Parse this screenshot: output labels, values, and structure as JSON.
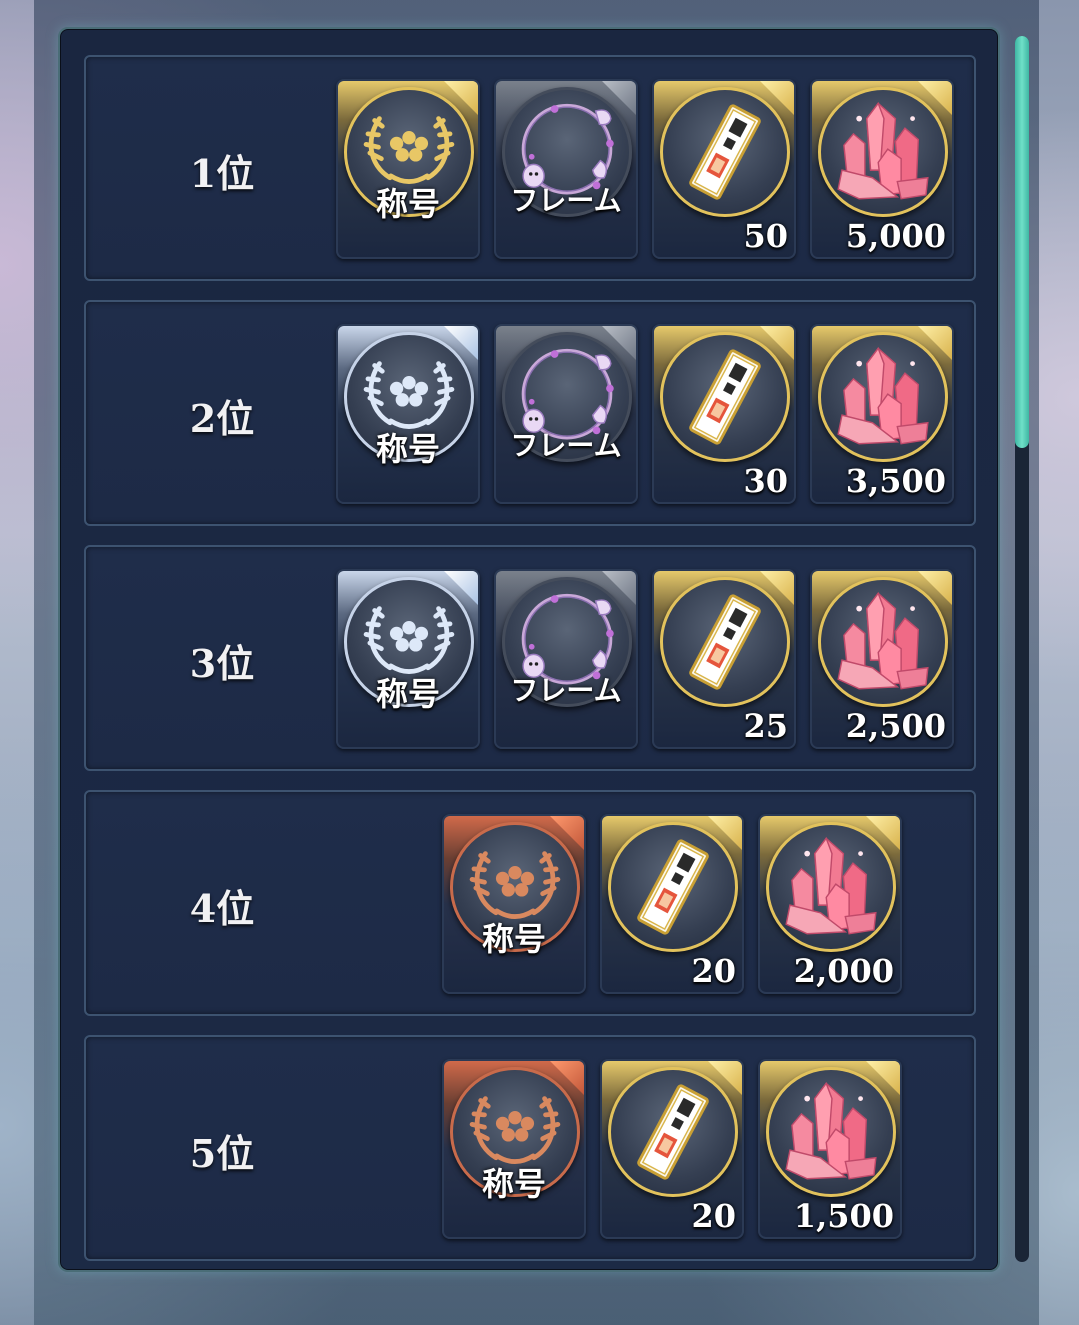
{
  "rewards": [
    {
      "rank": "1位",
      "items": [
        {
          "type": "title",
          "label": "称号",
          "tier": "gold",
          "icon": "laurel-emblem-gold-icon"
        },
        {
          "type": "frame",
          "label": "フレーム",
          "tier": "gray",
          "icon": "ghost-frame-purple-icon"
        },
        {
          "type": "ticket",
          "qty": "50",
          "tier": "gold",
          "icon": "ticket-icon"
        },
        {
          "type": "crystal",
          "qty": "5,000",
          "tier": "gold",
          "icon": "pink-crystal-icon"
        }
      ]
    },
    {
      "rank": "2位",
      "items": [
        {
          "type": "title",
          "label": "称号",
          "tier": "silver",
          "icon": "laurel-emblem-silver-icon"
        },
        {
          "type": "frame",
          "label": "フレーム",
          "tier": "gray",
          "icon": "ghost-frame-silver-icon"
        },
        {
          "type": "ticket",
          "qty": "30",
          "tier": "gold",
          "icon": "ticket-icon"
        },
        {
          "type": "crystal",
          "qty": "3,500",
          "tier": "gold",
          "icon": "pink-crystal-icon"
        }
      ]
    },
    {
      "rank": "3位",
      "items": [
        {
          "type": "title",
          "label": "称号",
          "tier": "silver",
          "icon": "laurel-emblem-silver-icon"
        },
        {
          "type": "frame",
          "label": "フレーム",
          "tier": "gray",
          "icon": "ghost-frame-bronze-icon"
        },
        {
          "type": "ticket",
          "qty": "25",
          "tier": "gold",
          "icon": "ticket-icon"
        },
        {
          "type": "crystal",
          "qty": "2,500",
          "tier": "gold",
          "icon": "pink-crystal-icon"
        }
      ]
    },
    {
      "rank": "4位",
      "items": [
        {
          "type": "title",
          "label": "称号",
          "tier": "bronze",
          "icon": "laurel-emblem-bronze-icon"
        },
        {
          "type": "ticket",
          "qty": "20",
          "tier": "gold",
          "icon": "ticket-icon"
        },
        {
          "type": "crystal",
          "qty": "2,000",
          "tier": "gold",
          "icon": "pink-crystal-icon"
        }
      ]
    },
    {
      "rank": "5位",
      "items": [
        {
          "type": "title",
          "label": "称号",
          "tier": "bronze",
          "icon": "laurel-emblem-bronze-icon"
        },
        {
          "type": "ticket",
          "qty": "20",
          "tier": "gold",
          "icon": "ticket-icon"
        },
        {
          "type": "crystal",
          "qty": "1,500",
          "tier": "gold",
          "icon": "pink-crystal-icon"
        }
      ]
    }
  ],
  "colors": {
    "gold": "#e2c25c",
    "silver": "#c6d3e8",
    "bronze": "#c96b4b",
    "scroll_accent": "#4fc9b3",
    "panel_bg": "#1a2640"
  }
}
